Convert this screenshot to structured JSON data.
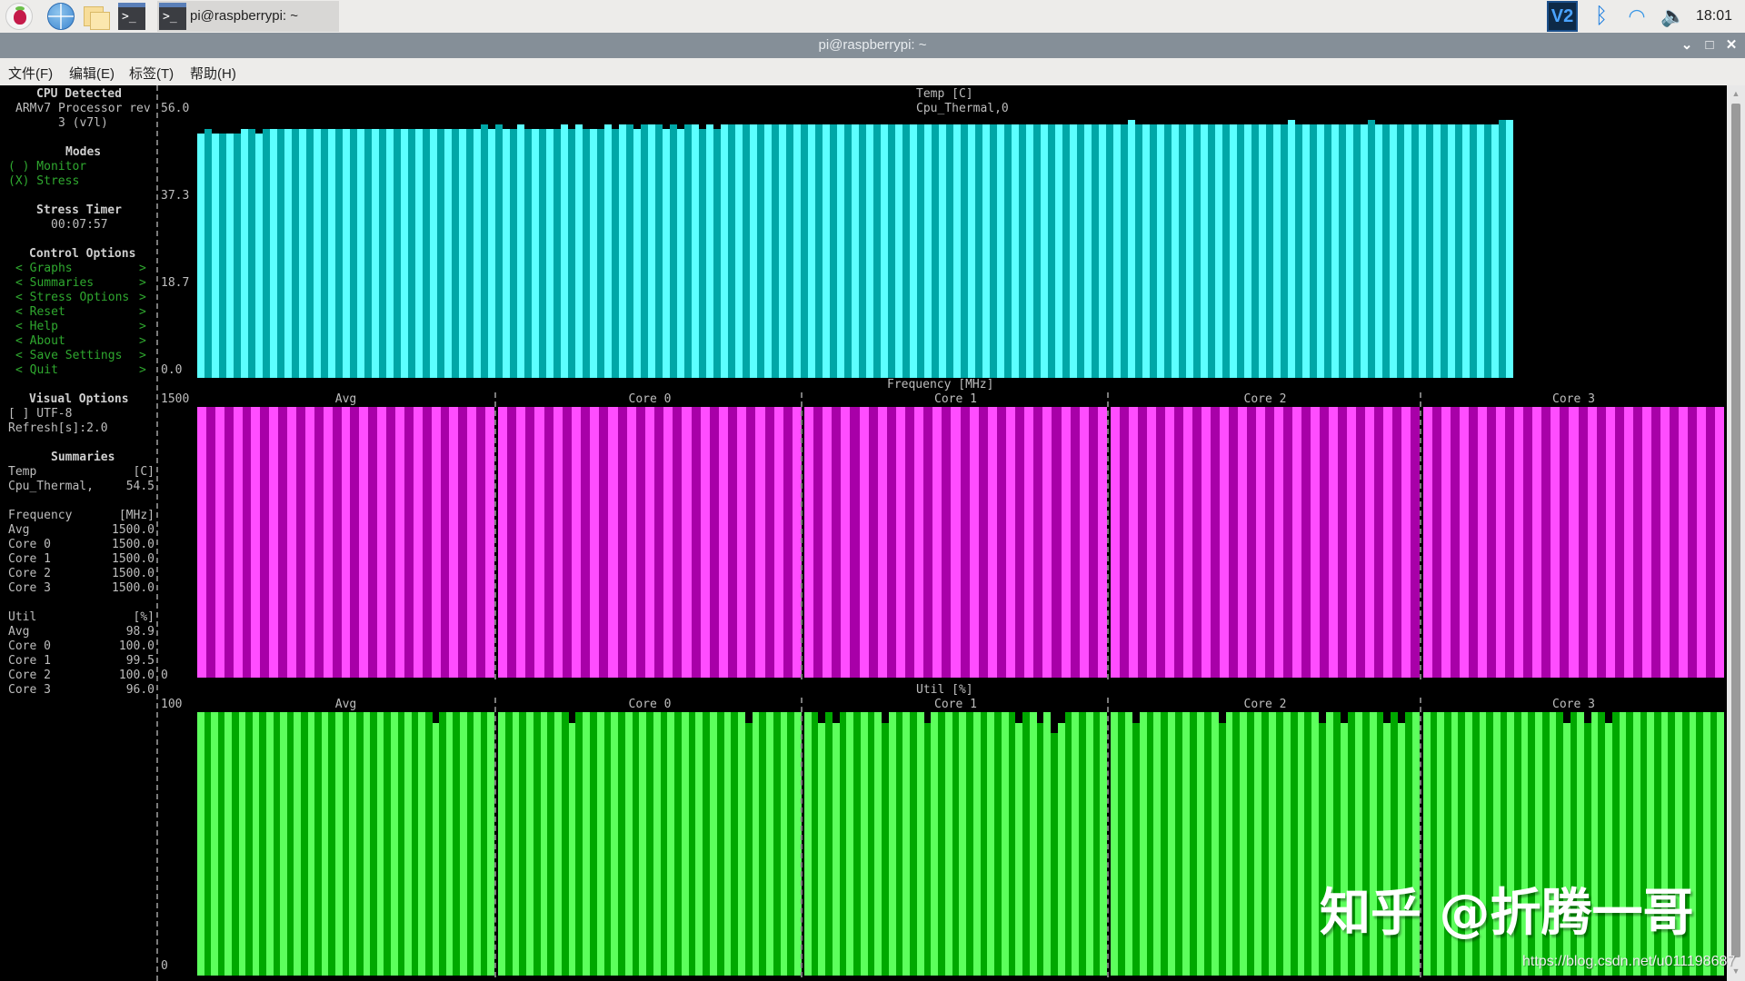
{
  "taskbar": {
    "task_label": "pi@raspberrypi: ~",
    "clock": "18:01",
    "icons": [
      "raspberry-menu-icon",
      "web-browser-icon",
      "file-manager-icon",
      "terminal-icon"
    ],
    "tray": [
      "vnc-icon",
      "bluetooth-icon",
      "wifi-icon",
      "volume-icon"
    ]
  },
  "window": {
    "title": "pi@raspberrypi: ~",
    "buttons": {
      "minimize": "⌄",
      "maximize": "□",
      "close": "✕"
    }
  },
  "menu": [
    "文件(F)",
    "编辑(E)",
    "标签(T)",
    "帮助(H)"
  ],
  "sidebar": {
    "cpu_header": "CPU Detected",
    "cpu_line1": "ARMv7 Processor rev",
    "cpu_line2": "3 (v7l)",
    "modes_header": "Modes",
    "mode_monitor": "( ) Monitor",
    "mode_stress": "(X) Stress",
    "timer_header": "Stress Timer",
    "timer_value": "00:07:57",
    "control_header": "Control Options",
    "controls": [
      "Graphs",
      "Summaries",
      "Stress Options",
      "Reset",
      "Help",
      "About",
      "Save Settings",
      "Quit"
    ],
    "visual_header": "Visual Options",
    "utf8": "[ ] UTF-8",
    "refresh": "Refresh[s]:2.0",
    "summaries_header": "Summaries",
    "temp": {
      "label": "Temp",
      "unit": "[C]",
      "rows": [
        {
          "name": "Cpu_Thermal,",
          "value": "54.5"
        }
      ]
    },
    "frequency": {
      "label": "Frequency",
      "unit": "[MHz]",
      "rows": [
        {
          "name": "Avg",
          "value": "1500.0"
        },
        {
          "name": "Core 0",
          "value": "1500.0"
        },
        {
          "name": "Core 1",
          "value": "1500.0"
        },
        {
          "name": "Core 2",
          "value": "1500.0"
        },
        {
          "name": "Core 3",
          "value": "1500.0"
        }
      ]
    },
    "util": {
      "label": "Util",
      "unit": "[%]",
      "rows": [
        {
          "name": "Avg",
          "value": "98.9"
        },
        {
          "name": "Core 0",
          "value": "100.0"
        },
        {
          "name": "Core 1",
          "value": "99.5"
        },
        {
          "name": "Core 2",
          "value": "100.0"
        },
        {
          "name": "Core 3",
          "value": "96.0"
        }
      ]
    }
  },
  "chart_data": [
    {
      "type": "bar",
      "title": "Temp [C]",
      "subtitle": "Cpu_Thermal,0",
      "yticks": [
        "56.0",
        "37.3",
        "18.7",
        "0.0"
      ],
      "ylim": [
        0,
        56.0
      ],
      "colors": [
        "#5cffff",
        "#00a7a7"
      ],
      "panels": [
        {
          "name": "Cpu_Thermal",
          "levels": [
            51.5,
            52.5,
            51.5,
            51.5,
            51.5,
            51.5,
            52.5,
            52.5,
            51.5,
            52.5,
            52.5,
            52.5,
            52.5,
            52.5,
            52.5,
            52.5,
            52.5,
            52.5,
            52.5,
            52.5,
            52.5,
            52.5,
            52.5,
            52.5,
            52.5,
            52.5,
            52.5,
            52.5,
            52.5,
            52.5,
            52.5,
            52.5,
            52.5,
            52.5,
            52.5,
            52.5,
            52.5,
            52.5,
            52.5,
            53.5,
            52.5,
            53.5,
            52.5,
            52.5,
            53.5,
            52.5,
            52.5,
            52.5,
            52.5,
            52.5,
            53.5,
            52.5,
            53.5,
            52.5,
            52.5,
            52.5,
            53.5,
            52.5,
            53.5,
            53.5,
            52.5,
            53.5,
            53.5,
            53.5,
            52.5,
            53.5,
            52.5,
            53.5,
            53.5,
            52.5,
            53.5,
            52.5,
            53.5,
            53.5,
            53.5,
            53.5,
            53.5,
            53.5,
            53.5,
            53.5,
            53.5,
            53.5,
            53.5,
            53.5,
            53.5,
            53.5,
            53.5,
            53.5,
            53.5,
            53.5,
            53.5,
            53.5,
            53.5,
            53.5,
            53.5,
            53.5,
            53.5,
            53.5,
            53.5,
            53.5,
            53.5,
            53.5,
            53.5,
            53.5,
            53.5,
            53.5,
            53.5,
            53.5,
            53.5,
            53.5,
            53.5,
            53.5,
            53.5,
            53.5,
            53.5,
            53.5,
            53.5,
            53.5,
            53.5,
            53.5,
            53.5,
            53.5,
            53.5,
            53.5,
            53.5,
            53.5,
            53.5,
            53.5,
            54.5,
            53.5,
            53.5,
            53.5,
            53.5,
            53.5,
            53.5,
            53.5,
            53.5,
            53.5,
            53.5,
            53.5,
            53.5,
            53.5,
            53.5,
            53.5,
            53.5,
            53.5,
            53.5,
            53.5,
            53.5,
            53.5,
            54.5,
            53.5,
            53.5,
            53.5,
            53.5,
            53.5,
            53.5,
            53.5,
            53.5,
            53.5,
            53.5,
            54.5,
            53.5,
            53.5,
            53.5,
            53.5,
            53.5,
            53.5,
            53.5,
            53.5,
            53.5,
            53.5,
            53.5,
            53.5,
            53.5,
            53.5,
            53.5,
            53.5,
            53.5,
            54.5,
            54.5
          ]
        }
      ]
    },
    {
      "type": "bar",
      "title": "Frequency [MHz]",
      "yticks": [
        "1500",
        "0"
      ],
      "ylim": [
        0,
        1500
      ],
      "colors": [
        "#ff4dff",
        "#a800a8"
      ],
      "panels": [
        {
          "name": "Avg",
          "value": 1500,
          "count": 33
        },
        {
          "name": "Core 0",
          "value": 1500,
          "count": 33
        },
        {
          "name": "Core 1",
          "value": 1500,
          "count": 33
        },
        {
          "name": "Core 2",
          "value": 1500,
          "count": 34
        },
        {
          "name": "Core 3",
          "value": 1500,
          "count": 33
        }
      ]
    },
    {
      "type": "bar",
      "title": "Util [%]",
      "yticks": [
        "100",
        "0"
      ],
      "ylim": [
        0,
        100
      ],
      "colors": [
        "#5cff5c",
        "#00a800"
      ],
      "panels": [
        {
          "name": "Avg",
          "levels": [
            100,
            100,
            100,
            100,
            100,
            100,
            100,
            100,
            100,
            100,
            100,
            100,
            100,
            100,
            100,
            100,
            100,
            100,
            100,
            100,
            100,
            100,
            100,
            100,
            100,
            100,
            100,
            100,
            100,
            100,
            100,
            100,
            100,
            100,
            96,
            100,
            100,
            100,
            100,
            100,
            100,
            100,
            100
          ]
        },
        {
          "name": "Core 0",
          "levels": [
            100,
            100,
            100,
            100,
            100,
            100,
            100,
            100,
            100,
            100,
            96,
            100,
            100,
            100,
            100,
            100,
            100,
            100,
            100,
            100,
            100,
            100,
            100,
            100,
            100,
            100,
            100,
            100,
            100,
            100,
            100,
            100,
            100,
            100,
            100,
            96,
            100,
            100,
            100,
            100,
            100,
            100,
            100
          ]
        },
        {
          "name": "Core 1",
          "levels": [
            100,
            100,
            96,
            100,
            96,
            100,
            100,
            100,
            100,
            100,
            100,
            96,
            100,
            100,
            100,
            100,
            100,
            96,
            100,
            100,
            100,
            100,
            100,
            100,
            100,
            100,
            100,
            100,
            100,
            100,
            96,
            100,
            100,
            96,
            100,
            92,
            96,
            100,
            100,
            100,
            100,
            100,
            100
          ]
        },
        {
          "name": "Core 2",
          "levels": [
            100,
            100,
            100,
            96,
            100,
            100,
            100,
            100,
            100,
            100,
            100,
            100,
            100,
            100,
            100,
            96,
            100,
            100,
            100,
            100,
            100,
            100,
            100,
            100,
            100,
            100,
            100,
            100,
            100,
            96,
            100,
            100,
            96,
            100,
            100,
            100,
            100,
            100,
            96,
            100,
            96,
            100,
            100
          ]
        },
        {
          "name": "Core 3",
          "levels": [
            100,
            100,
            100,
            100,
            100,
            100,
            100,
            100,
            100,
            100,
            100,
            100,
            100,
            100,
            100,
            100,
            100,
            100,
            100,
            100,
            96,
            100,
            100,
            96,
            100,
            100,
            96,
            100,
            100,
            100,
            100,
            100,
            100,
            100,
            100,
            100,
            100,
            100,
            100,
            100,
            100,
            100,
            100
          ]
        }
      ]
    }
  ],
  "watermark": {
    "text": "知乎 @折腾一哥",
    "url": "https://blog.csdn.net/u011198687"
  }
}
